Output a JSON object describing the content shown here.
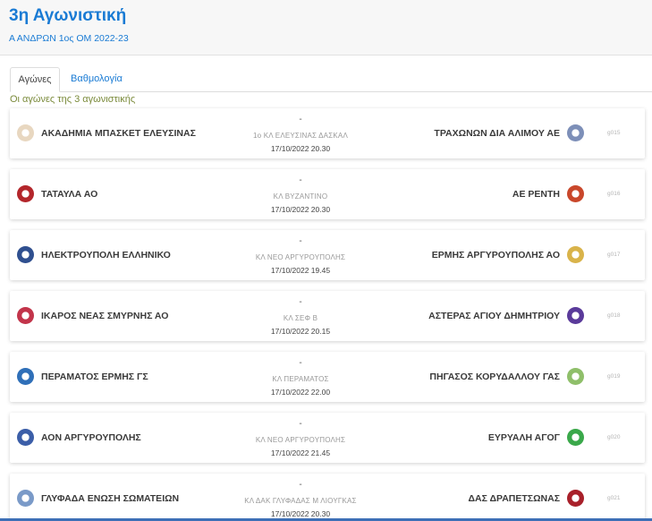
{
  "header": {
    "title": "3η Αγωνιστική",
    "subtitle": "Α ΑΝΔΡΩΝ 1ος ΟΜ 2022-23"
  },
  "tabs": [
    {
      "label": "Αγώνες",
      "active": true
    },
    {
      "label": "Βαθμολογία",
      "active": false
    }
  ],
  "subheading": "Οι αγώνες της 3 αγωνιστικής",
  "matches": [
    {
      "home": "ΑΚΑΔΗΜΙΑ ΜΠΑΣΚΕΤ ΕΛΕΥΣΙΝΑΣ",
      "away": "ΤΡΑΧΩΝΩΝ ΔΙΑ ΑΛΙΜΟΥ ΑΕ",
      "score": "-",
      "venue": "1ο ΚΛ ΕΛΕΥΣΙΝΑΣ ΔΑΣΚΑΛ",
      "datetime": "17/10/2022 20.30",
      "code": "g015",
      "home_logo_color": "#e8d7c0",
      "away_logo_color": "#7d8fb8"
    },
    {
      "home": "ΤΑΤΑΥΛΑ ΑΟ",
      "away": "ΑΕ ΡΕΝΤΗ",
      "score": "-",
      "venue": "ΚΛ ΒΥΖΑΝΤΙΝΟ",
      "datetime": "17/10/2022 20.30",
      "code": "g016",
      "home_logo_color": "#b3262b",
      "away_logo_color": "#c9472b"
    },
    {
      "home": "ΗΛΕΚΤΡΟΥΠΟΛΗ ΕΛΛΗΝΙΚΟ",
      "away": "ΕΡΜΗΣ ΑΡΓΥΡΟΥΠΟΛΗΣ ΑΟ",
      "score": "-",
      "venue": "ΚΛ ΝΕΟ ΑΡΓΥΡΟΥΠΟΛΗΣ",
      "datetime": "17/10/2022 19.45",
      "code": "g017",
      "home_logo_color": "#2f4f8f",
      "away_logo_color": "#d9b34a"
    },
    {
      "home": "ΙΚΑΡΟΣ ΝΕΑΣ ΣΜΥΡΝΗΣ ΑΟ",
      "away": "ΑΣΤΕΡΑΣ ΑΓΙΟΥ ΔΗΜΗΤΡΙΟΥ",
      "score": "-",
      "venue": "ΚΛ ΣΕΦ Β",
      "datetime": "17/10/2022 20.15",
      "code": "g018",
      "home_logo_color": "#c2344a",
      "away_logo_color": "#5a3a9a"
    },
    {
      "home": "ΠΕΡΑΜΑΤΟΣ ΕΡΜΗΣ ΓΣ",
      "away": "ΠΗΓΑΣΟΣ ΚΟΡΥΔΑΛΛΟΥ ΓΑΣ",
      "score": "-",
      "venue": "ΚΛ ΠΕΡΑΜΑΤΟΣ",
      "datetime": "17/10/2022 22.00",
      "code": "g019",
      "home_logo_color": "#2f6fb8",
      "away_logo_color": "#8fbf6a"
    },
    {
      "home": "ΑΟΝ ΑΡΓΥΡΟΥΠΟΛΗΣ",
      "away": "ΕΥΡΥΑΛΗ ΑΓΟΓ",
      "score": "-",
      "venue": "ΚΛ ΝΕΟ ΑΡΓΥΡΟΥΠΟΛΗΣ",
      "datetime": "17/10/2022 21.45",
      "code": "g020",
      "home_logo_color": "#3b5ea8",
      "away_logo_color": "#3aa84a"
    },
    {
      "home": "ΓΛΥΦΑΔΑ ΕΝΩΣΗ ΣΩΜΑΤΕΙΩΝ",
      "away": "ΔΑΣ ΔΡΑΠΕΤΣΩΝΑΣ",
      "score": "-",
      "venue": "ΚΛ ΔΑΚ ΓΛΥΦΑΔΑΣ Μ ΛΙΟΥΓΚΑΣ",
      "datetime": "17/10/2022 20.30",
      "code": "g021",
      "home_logo_color": "#7a9ac8",
      "away_logo_color": "#a8202a"
    }
  ]
}
